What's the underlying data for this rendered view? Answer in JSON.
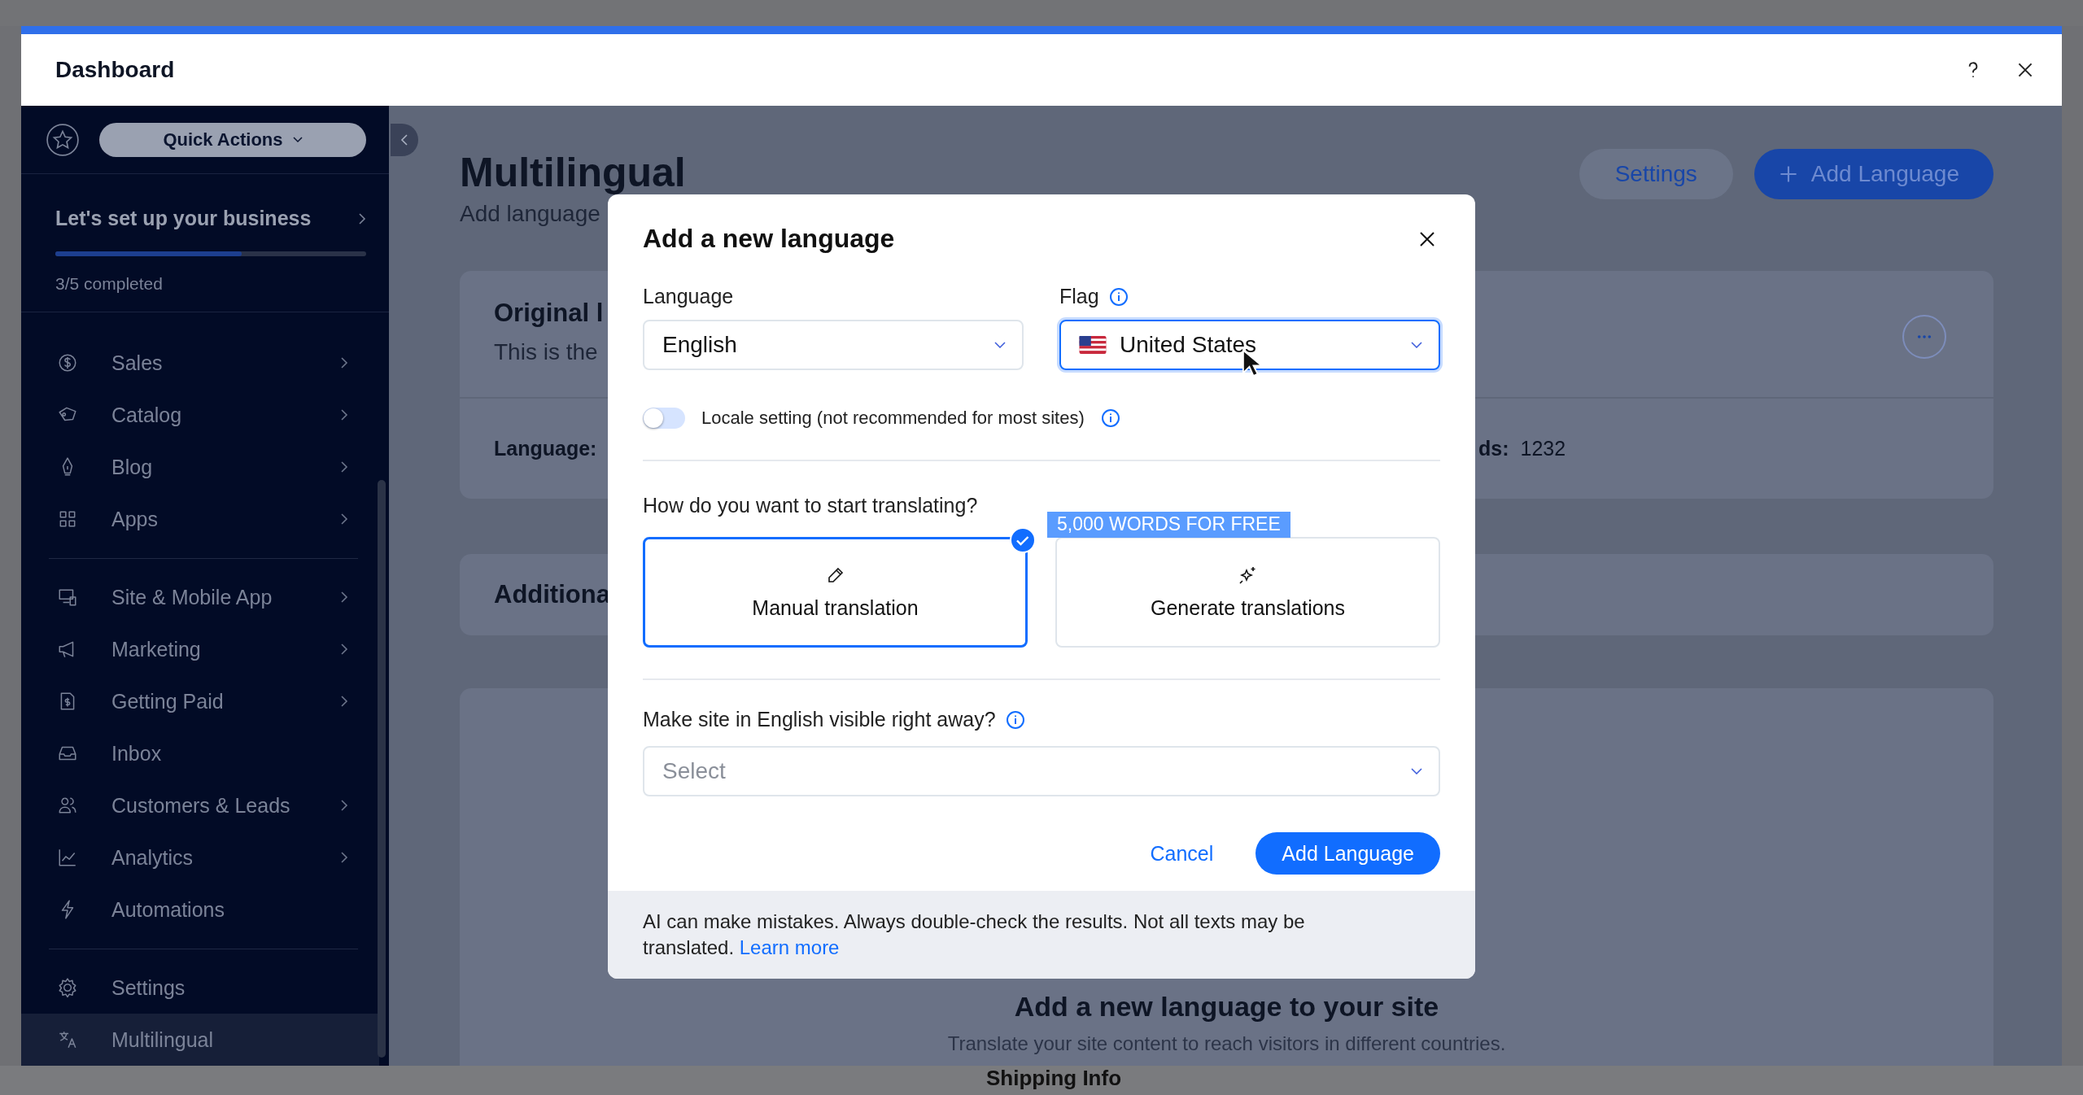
{
  "window": {
    "title": "Dashboard"
  },
  "sidebar": {
    "quick_actions": "Quick Actions",
    "setup": {
      "title": "Let's set up your business",
      "level": 0.6,
      "progress": "3/5 completed"
    },
    "groups": [
      [
        {
          "label": "Sales",
          "has_submenu": true,
          "selected": false
        },
        {
          "label": "Catalog",
          "has_submenu": true,
          "selected": false
        },
        {
          "label": "Blog",
          "has_submenu": true,
          "selected": false
        },
        {
          "label": "Apps",
          "has_submenu": true,
          "selected": false
        }
      ],
      [
        {
          "label": "Site & Mobile App",
          "has_submenu": true,
          "selected": false
        },
        {
          "label": "Marketing",
          "has_submenu": true,
          "selected": false
        },
        {
          "label": "Getting Paid",
          "has_submenu": true,
          "selected": false
        },
        {
          "label": "Inbox",
          "has_submenu": false,
          "selected": false
        },
        {
          "label": "Customers & Leads",
          "has_submenu": true,
          "selected": false
        },
        {
          "label": "Analytics",
          "has_submenu": true,
          "selected": false
        },
        {
          "label": "Automations",
          "has_submenu": false,
          "selected": false
        }
      ],
      [
        {
          "label": "Settings",
          "has_submenu": false,
          "selected": false
        },
        {
          "label": "Multilingual",
          "has_submenu": false,
          "selected": true
        }
      ]
    ]
  },
  "page": {
    "title": "Multilingual",
    "subtitle": "Add language",
    "buttons": [
      {
        "label": "Settings",
        "kind": "secondary"
      },
      {
        "label": "Add Language",
        "kind": "primary"
      }
    ],
    "original_card": {
      "title": "Original l",
      "description": "This is the",
      "language_label": "Language:",
      "words_label": "ds:",
      "words_value": "1232"
    },
    "additional_card": {
      "title": "Additiona"
    },
    "empty_state": {
      "title": "Add a new language to your site",
      "text": "Translate your site content to reach visitors in different countries."
    }
  },
  "dialog": {
    "title": "Add a new language",
    "language": {
      "label": "Language",
      "value": "English"
    },
    "flag": {
      "label": "Flag",
      "value": "United States",
      "focused": true
    },
    "locale": {
      "label": "Locale setting (not recommended for most sites)",
      "on": false
    },
    "question": "How do you want to start translating?",
    "options": [
      {
        "kind": "manual",
        "label": "Manual translation",
        "selected": true
      },
      {
        "kind": "ai",
        "label": "Generate translations",
        "selected": false,
        "badge": "5,000 WORDS FOR FREE"
      }
    ],
    "visibility": {
      "label": "Make site in English visible right away?",
      "placeholder": "Select"
    },
    "buttons": [
      {
        "kind": "text",
        "label": "Cancel"
      },
      {
        "kind": "primary",
        "label": "Add Language"
      }
    ],
    "footer": {
      "text": "AI can make mistakes. Always double-check the results. Not all texts may be translated.",
      "link": "Learn more"
    }
  },
  "bottom_strip": {
    "label": "Shipping Info"
  }
}
